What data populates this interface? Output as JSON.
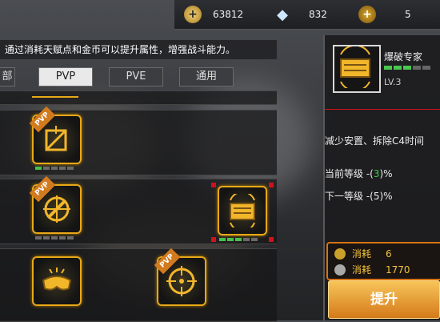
{
  "currency": {
    "gold": "63812",
    "diamond": "832",
    "rank": "5"
  },
  "info_text": "通过消耗天赋点和金币可以提升属性，增强战斗能力。",
  "tabs": [
    "部",
    "PVP",
    "PVE",
    "通用"
  ],
  "tabs_active_index": 1,
  "skills": [
    {
      "icon": "trap-icon",
      "badge": "PVP",
      "level_pips": [
        1,
        0,
        0,
        0,
        0
      ]
    },
    {
      "icon": "sniper-scope-icon",
      "badge": "PVP",
      "level_pips": [
        0,
        0,
        0,
        0,
        0
      ]
    },
    {
      "icon": "bomb-defuse-icon",
      "badge": "",
      "level_pips": [
        1,
        1,
        1,
        0,
        0
      ],
      "selected": true
    },
    {
      "icon": "goggles-icon",
      "badge": "",
      "level_pips": [
        0,
        0,
        0,
        0,
        0
      ]
    },
    {
      "icon": "crosshair-icon",
      "badge": "PVP",
      "level_pips": [
        0,
        0,
        0,
        0,
        0
      ]
    }
  ],
  "detail": {
    "name": "爆破专家",
    "level": "LV.3",
    "level_pips": [
      1,
      1,
      1,
      0,
      0
    ],
    "description": "减少安置、拆除C4时间",
    "current_label": "当前等级",
    "current_prefix": " -(",
    "current_value": "3",
    "current_suffix": ")%",
    "next_label": "下一等级",
    "next_value": " -(5)%"
  },
  "cost": {
    "label": "消耗",
    "talent_points": "6",
    "gold": "1770"
  },
  "upgrade_label": "提升",
  "colors": {
    "accent_gold": "#e8a817",
    "upgrade_button": "#e89a2b",
    "pip_on": "#46c34a",
    "pvp_badge": "#d27a1e"
  }
}
